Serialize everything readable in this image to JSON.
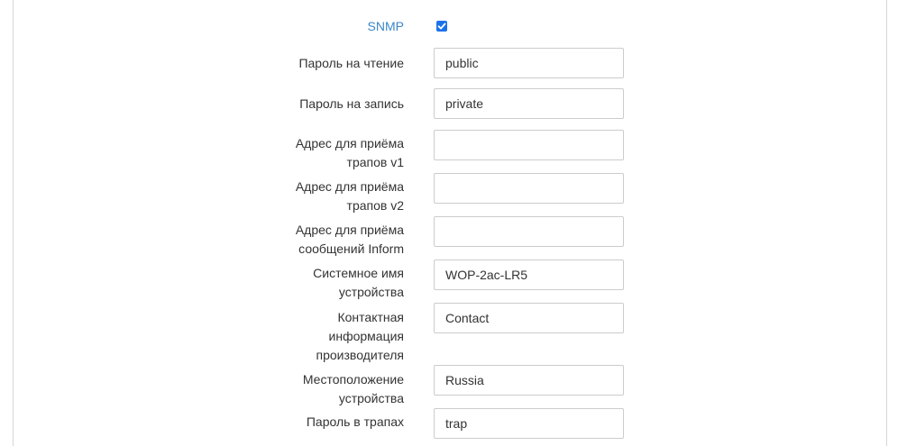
{
  "snmp": {
    "label": "SNMP",
    "enabled": true,
    "checkbox_color": "#1a73e8"
  },
  "fields": {
    "read_password": {
      "label": "Пароль на чтение",
      "value": "public"
    },
    "write_password": {
      "label": "Пароль на запись",
      "value": "private"
    },
    "trap_v1_addr": {
      "label_line1": "Адрес для приёма",
      "label_line2": "трапов v1",
      "value": ""
    },
    "trap_v2_addr": {
      "label_line1": "Адрес для приёма",
      "label_line2": "трапов v2",
      "value": ""
    },
    "inform_addr": {
      "label_line1": "Адрес для приёма",
      "label_line2": "сообщений Inform",
      "value": ""
    },
    "system_name": {
      "label_line1": "Системное имя",
      "label_line2": "устройства",
      "value": "WOP-2ac-LR5"
    },
    "contact": {
      "label_line1": "Контактная",
      "label_line2": "информация",
      "label_line3": "производителя",
      "value": "Contact"
    },
    "location": {
      "label_line1": "Местоположение",
      "label_line2": "устройства",
      "value": "Russia"
    },
    "trap_password": {
      "label": "Пароль в трапах",
      "value": "trap"
    }
  }
}
